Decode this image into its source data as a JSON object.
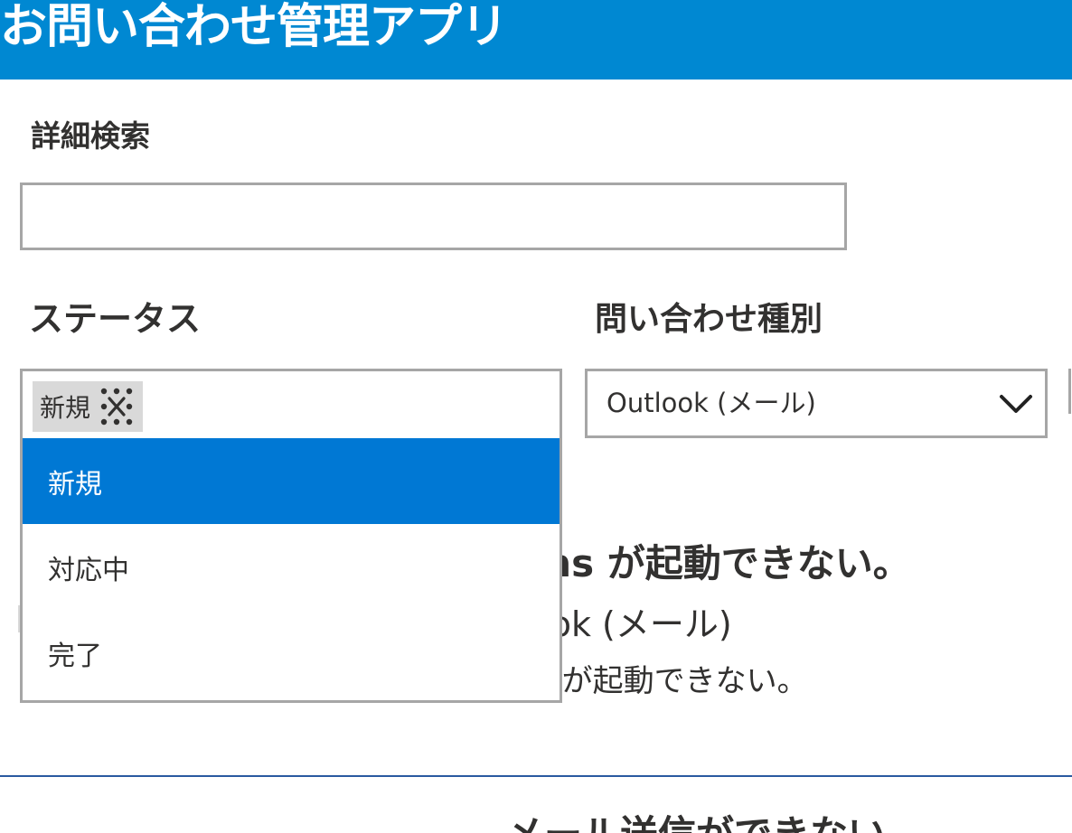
{
  "header": {
    "title": "お問い合わせ管理アプリ",
    "background_color": "#0088d2"
  },
  "search": {
    "label": "詳細検索",
    "value": "",
    "placeholder": ""
  },
  "status_filter": {
    "label": "ステータス",
    "selected_tags": [
      "新規"
    ],
    "options": [
      "新規",
      "対応中",
      "完了"
    ],
    "highlighted_option": "新規",
    "highlight_color": "#0078d4"
  },
  "type_filter": {
    "label": "問い合わせ種別",
    "value": "Outlook (メール)"
  },
  "records": [
    {
      "title_visible": "ams が起動できない。",
      "type_visible": "tlook (メール)",
      "description_visible": "ms が起動できない。"
    },
    {
      "title_visible": "メール送信ができない"
    }
  ]
}
